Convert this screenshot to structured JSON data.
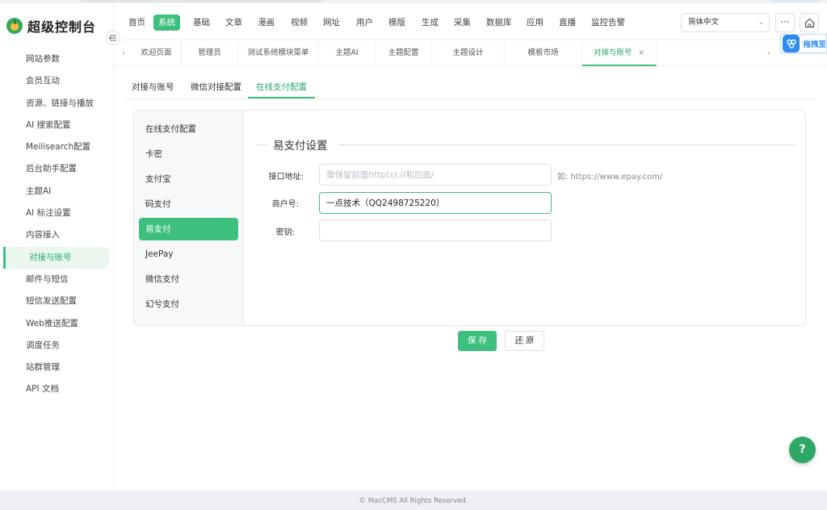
{
  "app": {
    "title": "超级控制台"
  },
  "sidebar": {
    "items": [
      {
        "label": "网站参数"
      },
      {
        "label": "会员互动"
      },
      {
        "label": "资源、链接与播放"
      },
      {
        "label": "AI 搜索配置"
      },
      {
        "label": "Meilisearch配置"
      },
      {
        "label": "后台助手配置"
      },
      {
        "label": "主题AI"
      },
      {
        "label": "AI 标注设置"
      },
      {
        "label": "内容接入"
      },
      {
        "label": "对接与账号",
        "active": true
      },
      {
        "label": "邮件与短信"
      },
      {
        "label": "短信发送配置"
      },
      {
        "label": "Web推送配置"
      },
      {
        "label": "调度任务"
      },
      {
        "label": "站群管理"
      },
      {
        "label": "API 文档"
      }
    ]
  },
  "topnav": {
    "items": [
      "首页",
      "系统",
      "基础",
      "文章",
      "漫画",
      "视频",
      "网址",
      "用户",
      "模版",
      "生成",
      "采集",
      "数据库",
      "应用",
      "直播",
      "监控告警"
    ],
    "active": "系统",
    "language": "简体中文",
    "more_label": "···"
  },
  "tabs": {
    "items": [
      {
        "label": "欢迎页面"
      },
      {
        "label": "管理员"
      },
      {
        "label": "测试系统模块菜单"
      },
      {
        "label": "主题AI"
      },
      {
        "label": "主题配置"
      },
      {
        "label": "主题设计"
      },
      {
        "label": "模板市场"
      },
      {
        "label": "对接与账号",
        "active": true,
        "close": "×"
      }
    ]
  },
  "drag_widget": {
    "label": "拖拽至"
  },
  "sub_tabs": {
    "items": [
      {
        "label": "对接与账号"
      },
      {
        "label": "微信对接配置"
      },
      {
        "label": "在线支付配置",
        "active": true
      }
    ]
  },
  "pay_menu": {
    "items": [
      {
        "label": "在线支付配置"
      },
      {
        "label": "卡密"
      },
      {
        "label": "支付宝"
      },
      {
        "label": "码支付"
      },
      {
        "label": "易支付",
        "active": true
      },
      {
        "label": "JeePay"
      },
      {
        "label": "微信支付"
      },
      {
        "label": "幻兮支付"
      }
    ]
  },
  "form": {
    "section_title": "易支付设置",
    "api_url": {
      "label": "接口地址:",
      "value": "",
      "placeholder": "需保留前面http(s)://和后面/",
      "hint": "如: https://www.epay.com/"
    },
    "merchant_id": {
      "label": "商户号:",
      "value": "一点技术（QQ2498725220）"
    },
    "secret_key": {
      "label": "密钥:",
      "value": ""
    }
  },
  "actions": {
    "save": "保 存",
    "reset": "还 原"
  },
  "help": {
    "label": "?"
  },
  "footer": {
    "text": "© MacCMS All Rights Reserved."
  },
  "colors": {
    "accent": "#3dbf7e",
    "accent_dark": "#2ba86b",
    "help_bg": "#2fa866",
    "widget_blue": "#2d8cf0"
  }
}
